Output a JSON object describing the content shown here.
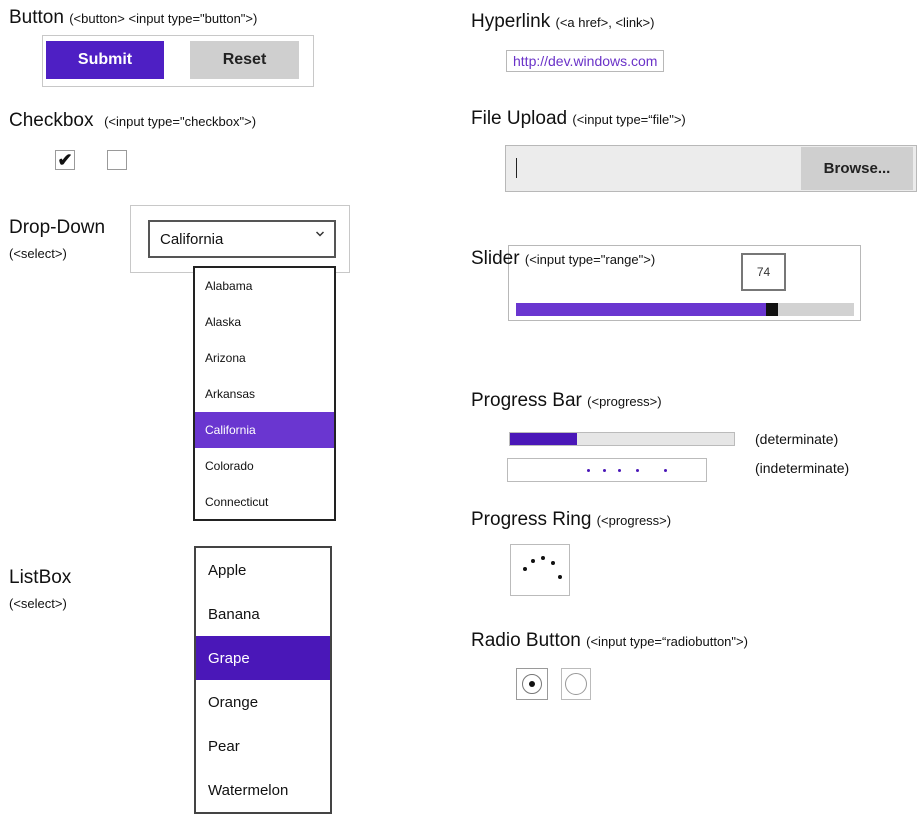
{
  "button_section": {
    "title": "Button",
    "code": "(<button> <input type=\"button\">)",
    "submit_label": "Submit",
    "reset_label": "Reset"
  },
  "checkbox_section": {
    "title": "Checkbox",
    "code": "(<input type=\"checkbox\">)",
    "items": [
      {
        "checked": true
      },
      {
        "checked": false
      }
    ]
  },
  "dropdown_section": {
    "title": "Drop-Down",
    "code": "(<select>)",
    "selected": "California",
    "options": [
      "Alabama",
      "Alaska",
      "Arizona",
      "Arkansas",
      "California",
      "Colorado",
      "Connecticut"
    ]
  },
  "listbox_section": {
    "title": "ListBox",
    "code": "(<select>)",
    "selected": "Grape",
    "options": [
      "Apple",
      "Banana",
      "Grape",
      "Orange",
      "Pear",
      "Watermelon"
    ]
  },
  "hyperlink_section": {
    "title": "Hyperlink",
    "code": "(<a href>, <link>)",
    "link_text": "http://dev.windows.com"
  },
  "file_section": {
    "title": "File Upload",
    "code": "(<input type=“file\">)",
    "browse_label": "Browse..."
  },
  "slider_section": {
    "title": "Slider",
    "code": "(<input type=\"range\">)",
    "value": "74",
    "fill_fraction": 0.74
  },
  "progress_section": {
    "title": "Progress Bar",
    "code": "(<progress>)",
    "determinate_label": "(determinate)",
    "indeterminate_label": "(indeterminate)",
    "determinate_fraction": 0.3
  },
  "ring_section": {
    "title": "Progress Ring",
    "code": "(<progress>)"
  },
  "radio_section": {
    "title": "Radio Button",
    "code": "(<input type=“radiobutton\">)",
    "items": [
      {
        "selected": true
      },
      {
        "selected": false
      }
    ]
  },
  "colors": {
    "accent": "#4e1fc4",
    "accent_light": "#6a36d0",
    "reset_bg": "#cfcfcf"
  }
}
